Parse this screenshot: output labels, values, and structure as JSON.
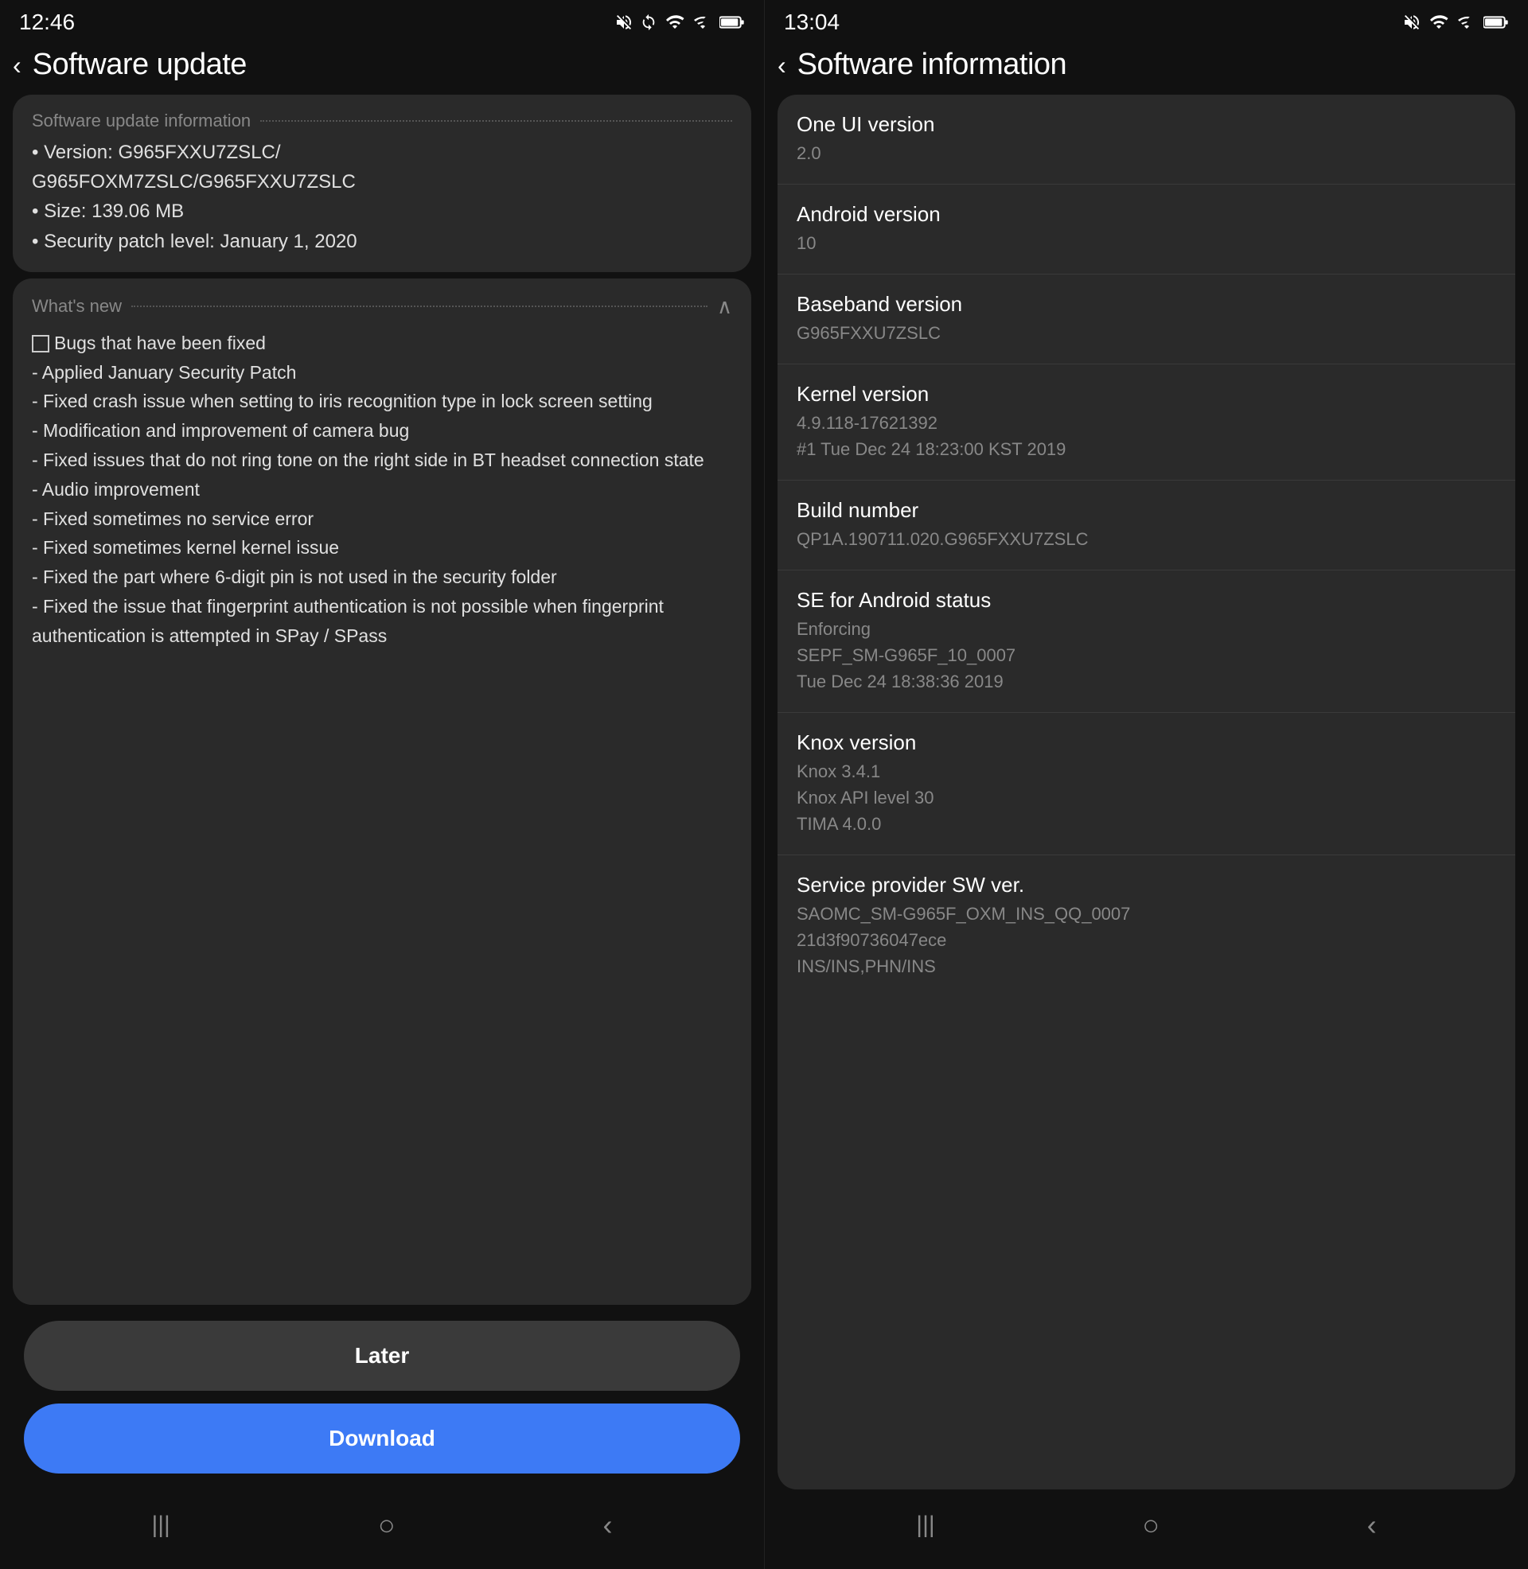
{
  "left_panel": {
    "status_bar": {
      "time": "12:46",
      "icons": [
        "silent",
        "sync",
        "wifi",
        "signal",
        "battery"
      ]
    },
    "header": {
      "back_label": "‹",
      "title": "Software update"
    },
    "update_info_section": {
      "section_title": "Software update information",
      "version_line": "• Version: G965FXXU7ZSLC/",
      "version_line2": "  G965FOXM7ZSLC/G965FXXU7ZSLC",
      "size_line": "• Size: 139.06 MB",
      "security_line": "• Security patch level: January 1, 2020"
    },
    "whats_new_section": {
      "section_title": "What's new",
      "items": [
        "☐ Bugs that have been fixed",
        " - Applied January Security Patch",
        " - Fixed crash issue when setting to iris recognition type in lock screen setting",
        " - Modification and improvement of camera bug",
        " - Fixed issues that do not ring tone on the right side in BT headset connection state",
        " - Audio improvement",
        " - Fixed sometimes no service error",
        " - Fixed sometimes kernel kernel issue",
        " - Fixed the part where 6-digit pin is not used in the security folder",
        " - Fixed the issue that fingerprint authentication is not possible when fingerprint authentication is attempted in SPay / SPass"
      ]
    },
    "buttons": {
      "later_label": "Later",
      "download_label": "Download"
    },
    "nav_bar": {
      "menu_icon": "|||",
      "home_icon": "○",
      "back_icon": "‹"
    }
  },
  "right_panel": {
    "status_bar": {
      "time": "13:04",
      "icons": [
        "silent",
        "wifi",
        "signal",
        "battery"
      ]
    },
    "header": {
      "back_label": "‹",
      "title": "Software information"
    },
    "info_items": [
      {
        "label": "One UI version",
        "value": "2.0"
      },
      {
        "label": "Android version",
        "value": "10"
      },
      {
        "label": "Baseband version",
        "value": "G965FXXU7ZSLC"
      },
      {
        "label": "Kernel version",
        "value": "4.9.118-17621392\n#1 Tue Dec 24 18:23:00 KST 2019"
      },
      {
        "label": "Build number",
        "value": "QP1A.190711.020.G965FXXU7ZSLC"
      },
      {
        "label": "SE for Android status",
        "value": "Enforcing\nSEPF_SM-G965F_10_0007\nTue Dec 24 18:38:36 2019"
      },
      {
        "label": "Knox version",
        "value": "Knox 3.4.1\nKnox API level 30\nTIMA 4.0.0"
      },
      {
        "label": "Service provider SW ver.",
        "value": "SAOMC_SM-G965F_OXM_INS_QQ_0007\n21d3f90736047ece\nINS/INS,PHN/INS"
      }
    ],
    "nav_bar": {
      "menu_icon": "|||",
      "home_icon": "○",
      "back_icon": "‹"
    }
  }
}
